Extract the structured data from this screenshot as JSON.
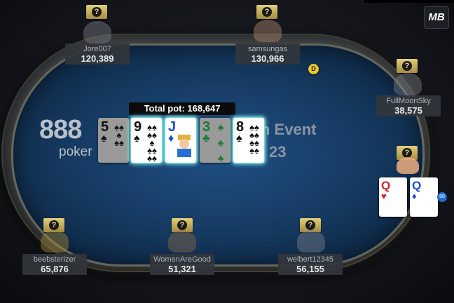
{
  "brand": {
    "logo_top": "888",
    "logo_bottom": "poker",
    "corner_logo": "MB"
  },
  "event": {
    "title_fragment": "n Event",
    "year_fragment": "23"
  },
  "pot": {
    "label": "Total pot: 168,647"
  },
  "board": [
    {
      "rank": "5",
      "suit": "♠",
      "color": "black",
      "dimmed": true,
      "highlight": false
    },
    {
      "rank": "9",
      "suit": "♠",
      "color": "black",
      "dimmed": false,
      "highlight": true
    },
    {
      "rank": "J",
      "suit": "♦",
      "color": "blue",
      "dimmed": false,
      "highlight": true
    },
    {
      "rank": "3",
      "suit": "♣",
      "color": "green",
      "dimmed": true,
      "highlight": false
    },
    {
      "rank": "8",
      "suit": "♠",
      "color": "black",
      "dimmed": false,
      "highlight": true
    }
  ],
  "hero_cards": [
    {
      "rank": "Q",
      "suit": "♥",
      "color": "red"
    },
    {
      "rank": "Q",
      "suit": "♦",
      "color": "blue"
    }
  ],
  "dealer_button": "D",
  "help_icon": "?",
  "seats": [
    {
      "name": "Jore007",
      "stack": "120,389"
    },
    {
      "name": "samsungas",
      "stack": "130,966"
    },
    {
      "name": "FullMoonSky",
      "stack": "38,575"
    },
    {
      "name": "beebsterizer",
      "stack": "65,876"
    },
    {
      "name": "WomenAreGood",
      "stack": "51,321"
    },
    {
      "name": "welbert12345",
      "stack": "56,155"
    }
  ],
  "hero_badge": "88"
}
